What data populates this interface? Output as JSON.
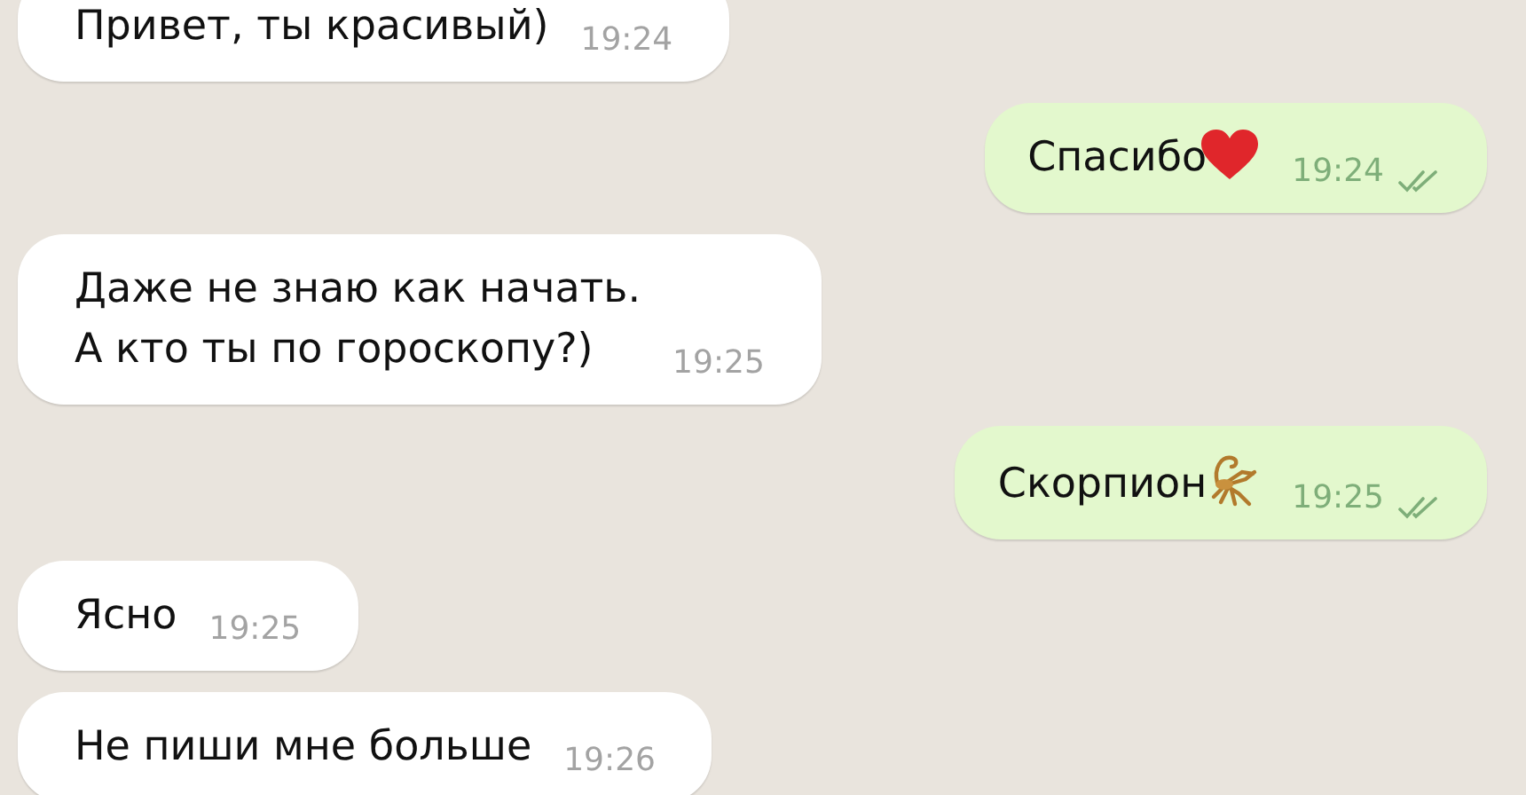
{
  "messages": [
    {
      "kind": "incoming",
      "lines": [
        "Привет, ты красивый)"
      ],
      "time": "19:24"
    },
    {
      "kind": "outgoing",
      "lines": [
        "Спасибо"
      ],
      "emoji": {
        "kind": "heart"
      },
      "time": "19:24",
      "read": true
    },
    {
      "kind": "incoming",
      "lines": [
        "Даже не знаю как начать.",
        "А кто ты по гороскопу?)"
      ],
      "time": "19:25"
    },
    {
      "kind": "outgoing",
      "lines": [
        "Скорпион"
      ],
      "emoji": {
        "kind": "scorpion"
      },
      "time": "19:25",
      "read": true
    },
    {
      "kind": "incoming",
      "lines": [
        "Ясно"
      ],
      "time": "19:25"
    },
    {
      "kind": "incoming",
      "lines": [
        "Не пиши мне больше"
      ],
      "time": "19:26"
    }
  ]
}
